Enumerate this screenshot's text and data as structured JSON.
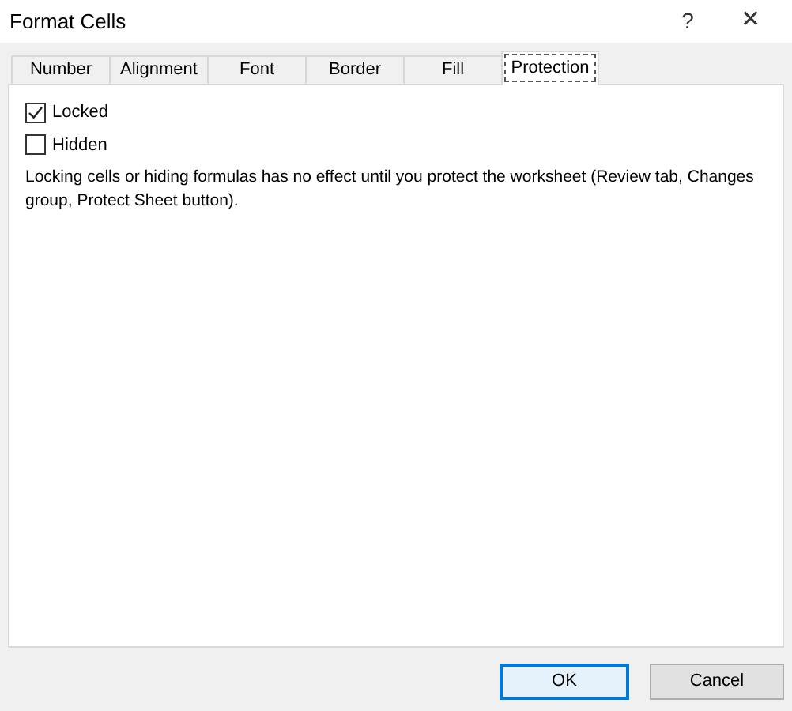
{
  "window": {
    "title": "Format Cells",
    "help": "?",
    "close": "✕"
  },
  "tabs": [
    {
      "label": "Number",
      "selected": false
    },
    {
      "label": "Alignment",
      "selected": false
    },
    {
      "label": "Font",
      "selected": false
    },
    {
      "label": "Border",
      "selected": false
    },
    {
      "label": "Fill",
      "selected": false
    },
    {
      "label": "Protection",
      "selected": true
    }
  ],
  "options": [
    {
      "label": "Locked",
      "checked": true
    },
    {
      "label": "Hidden",
      "checked": false
    }
  ],
  "note": "Locking cells or hiding formulas has no effect until you protect the worksheet (Review tab, Changes group, Protect Sheet button).",
  "buttons": [
    {
      "label": "OK",
      "default": true
    },
    {
      "label": "Cancel",
      "default": false
    }
  ]
}
